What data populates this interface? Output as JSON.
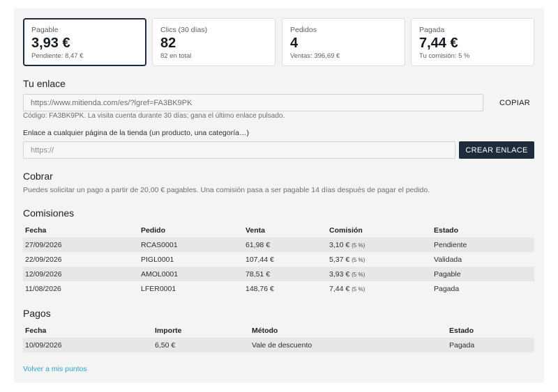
{
  "stats": [
    {
      "label": "Pagable",
      "value": "3,93 €",
      "sub": "Pendiente: 8,47 €"
    },
    {
      "label": "Clics (30 días)",
      "value": "82",
      "sub": "82 en total"
    },
    {
      "label": "Pedidos",
      "value": "4",
      "sub": "Ventas: 396,69 €"
    },
    {
      "label": "Pagada",
      "value": "7,44 €",
      "sub": "Tu comisión: 5 %"
    }
  ],
  "link_section": {
    "title": "Tu enlace",
    "url": "https://www.mitienda.com/es/?lgref=FA3BK9PK",
    "copy_label": "COPIAR",
    "code_note": "Código: FA3BK9PK. La visita cuenta durante 30 días; gana el último enlace pulsado.",
    "any_page_label": "Enlace a cualquier página de la tienda (un producto, una categoría…)",
    "any_page_placeholder": "https://",
    "create_label": "CREAR ENLACE"
  },
  "cobrar": {
    "title": "Cobrar",
    "note": "Puedes solicitar un pago a partir de 20,00 € pagables. Una comisión pasa a ser pagable 14 días después de pagar el pedido."
  },
  "commissions": {
    "title": "Comisiones",
    "headers": [
      "Fecha",
      "Pedido",
      "Venta",
      "Comisión",
      "Estado"
    ],
    "rows": [
      {
        "date": "27/09/2026",
        "order": "RCAS0001",
        "sale": "61,98 €",
        "commission": "3,10 €",
        "pct": "(5 %)",
        "status": "Pendiente"
      },
      {
        "date": "22/09/2026",
        "order": "PIGL0001",
        "sale": "107,44 €",
        "commission": "5,37 €",
        "pct": "(5 %)",
        "status": "Validada"
      },
      {
        "date": "12/09/2026",
        "order": "AMOL0001",
        "sale": "78,51 €",
        "commission": "3,93 €",
        "pct": "(5 %)",
        "status": "Pagable"
      },
      {
        "date": "11/08/2026",
        "order": "LFER0001",
        "sale": "148,76 €",
        "commission": "7,44 €",
        "pct": "(5 %)",
        "status": "Pagada"
      }
    ]
  },
  "payments": {
    "title": "Pagos",
    "headers": [
      "Fecha",
      "Importe",
      "Método",
      "Estado"
    ],
    "rows": [
      {
        "date": "10/09/2026",
        "amount": "6,50 €",
        "method": "Vale de descuento",
        "status": "Pagada"
      }
    ]
  },
  "back_link": "Volver a mis puntos"
}
